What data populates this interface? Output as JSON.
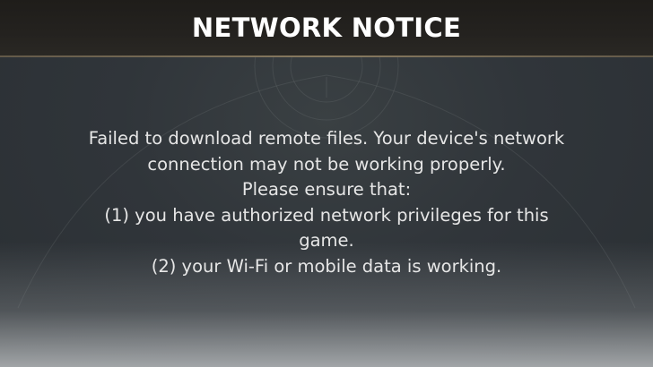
{
  "dialog": {
    "title": "NETWORK NOTICE",
    "message_lines": [
      "Failed to download remote files. Your device's network",
      "connection may not be working properly.",
      "Please ensure that:",
      "(1) you have authorized network privileges for this",
      "game.",
      "(2) your Wi-Fi or mobile data is working."
    ]
  },
  "colors": {
    "title_text": "#ffffff",
    "message_text": "#e6e6e6",
    "header_background": "#24221f",
    "accent_rule": "#9a8a6c",
    "panel_background": "#30353a"
  }
}
